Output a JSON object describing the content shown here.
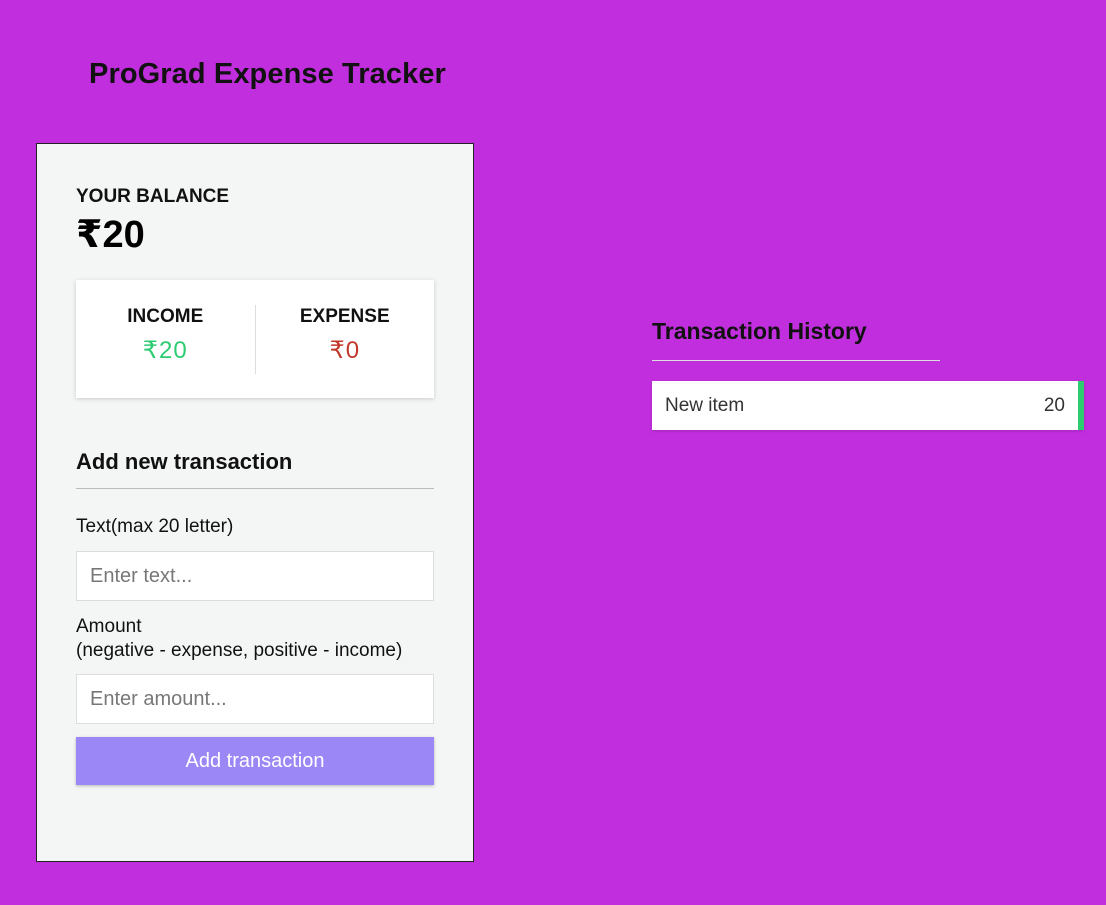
{
  "app": {
    "title": "ProGrad Expense Tracker"
  },
  "balance": {
    "label": "YOUR BALANCE",
    "value": "₹20"
  },
  "summary": {
    "income_label": "INCOME",
    "income_value": "₹20",
    "expense_label": "EXPENSE",
    "expense_value": "₹0"
  },
  "form": {
    "heading": "Add new transaction",
    "text_label": "Text(max 20 letter)",
    "text_placeholder": "Enter text...",
    "amount_label_line1": "Amount",
    "amount_label_line2": "(negative - expense, positive - income)",
    "amount_placeholder": "Enter amount...",
    "submit_label": "Add transaction"
  },
  "history": {
    "heading": "Transaction History",
    "items": [
      {
        "text": "New item",
        "amount": "20"
      }
    ]
  },
  "colors": {
    "background": "#c12edd",
    "income": "#2ecc71",
    "expense": "#c0392b",
    "button": "#9b87f5"
  }
}
